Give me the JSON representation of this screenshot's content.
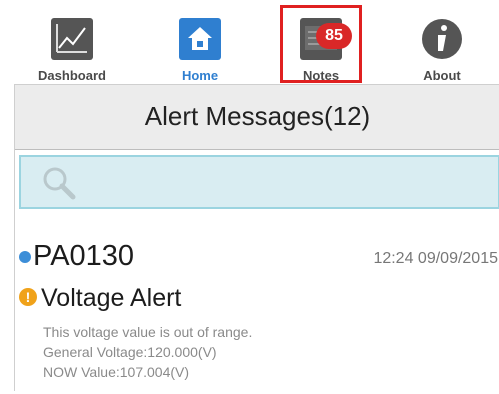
{
  "tabbar": {
    "tabs": [
      {
        "label": "Dashboard",
        "icon": "chart-icon"
      },
      {
        "label": "Home",
        "icon": "home-icon"
      },
      {
        "label": "Notes",
        "icon": "notes-icon",
        "badge": "85"
      },
      {
        "label": "About",
        "icon": "info-icon"
      }
    ]
  },
  "header": {
    "title": "Alert Messages(12)"
  },
  "search": {
    "placeholder": "",
    "value": ""
  },
  "alerts": [
    {
      "id": "PA0130",
      "time": "12:24 09/09/2015",
      "type": "Voltage Alert",
      "status_icon": "warning-icon",
      "lines": [
        "This voltage value is out of range.",
        "General Voltage:120.000(V)",
        "NOW Value:107.004(V)"
      ]
    }
  ],
  "colors": {
    "accent": "#2f7fd0",
    "badge": "#d92828",
    "highlight": "#e02020",
    "search_bg": "#d9edf2",
    "warning": "#f0a21a"
  }
}
